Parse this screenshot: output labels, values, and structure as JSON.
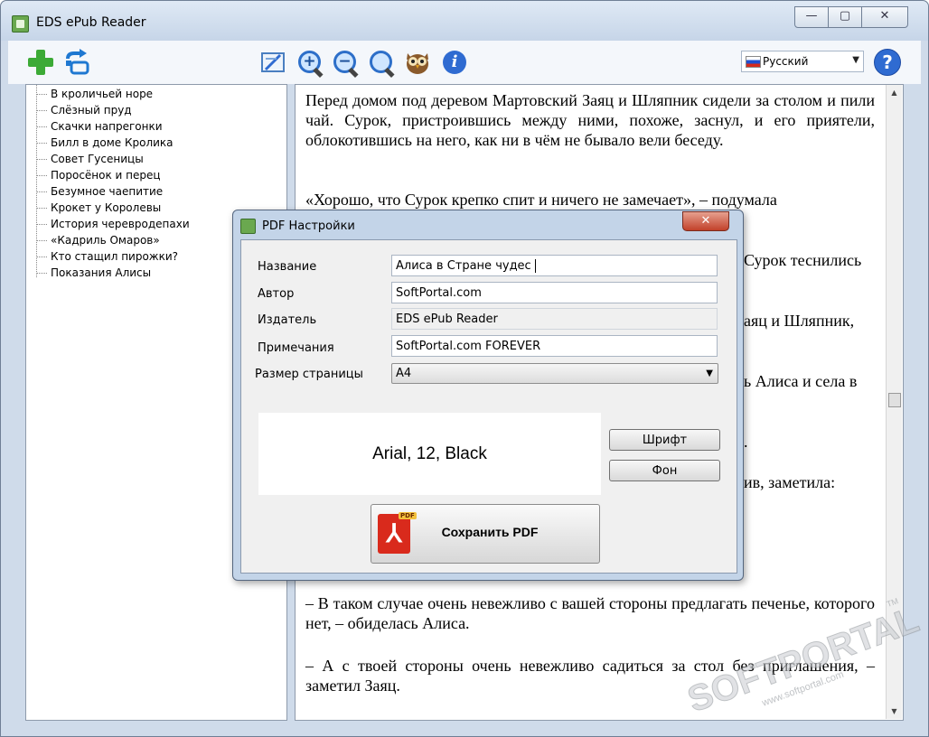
{
  "window": {
    "title": "EDS ePub Reader",
    "controls": {
      "minimize": "—",
      "maximize": "▢",
      "close": "✕"
    }
  },
  "toolbar": {
    "icons": [
      "add-icon",
      "convert-icon",
      "fit-page-icon",
      "zoom-in-icon",
      "zoom-out-icon",
      "zoom-reset-icon",
      "owl-icon",
      "info-icon",
      "help-icon"
    ],
    "language": "Русский",
    "info_glyph": "i",
    "help_glyph": "?"
  },
  "toc": {
    "items": [
      "В кроличьей норе",
      "Слёзный пруд",
      "Скачки напрегонки",
      "Билл в доме Кролика",
      "Совет Гусеницы",
      "Поросёнок и перец",
      "Безумное чаепитие",
      "Крокет у Королевы",
      "История черевродепахи",
      "«Кадриль Омаров»",
      "Кто стащил пирожки?",
      "Показания Алисы"
    ]
  },
  "reader": {
    "paragraphs": [
      "Перед домом под деревом Мартовский Заяц и Шляпник сидели за столом и пили чай. Сурок, пристроившись между ними, похоже, заснул, и его приятели, облокотившись на него, как ни в чём не бывало вели беседу.",
      "«Хорошо, что Сурок крепко спит и ничего не замечает», – подумала",
      "Сурок теснились",
      "аяц и Шляпник,",
      "ь Алиса и села в",
      ".",
      "ив, заметила:",
      "– В таком случае очень невежливо с вашей стороны предлагать печенье, которого нет, – обиделась Алиса.",
      "– А с твоей стороны очень невежливо садиться за стол без приглашения, – заметил Заяц."
    ]
  },
  "dialog": {
    "title": "PDF Настройки",
    "close_glyph": "✕",
    "fields": {
      "title_label": "Название",
      "title_value": "Алиса в Стране чудес",
      "author_label": "Автор",
      "author_value": "SoftPortal.com",
      "publisher_label": "Издатель",
      "publisher_value": "EDS ePub Reader",
      "notes_label": "Примечания",
      "notes_value": "SoftPortal.com FOREVER",
      "page_size_label": "Размер страницы",
      "page_size_value": "A4"
    },
    "font_preview": "Arial, 12, Black",
    "font_button": "Шрифт",
    "background_button": "Фон",
    "save_button": "Сохранить PDF",
    "pdf_tag": "PDF"
  },
  "watermark": {
    "brand": "SOFTPORTAL",
    "url": "www.softportal.com",
    "tm": "TM"
  }
}
